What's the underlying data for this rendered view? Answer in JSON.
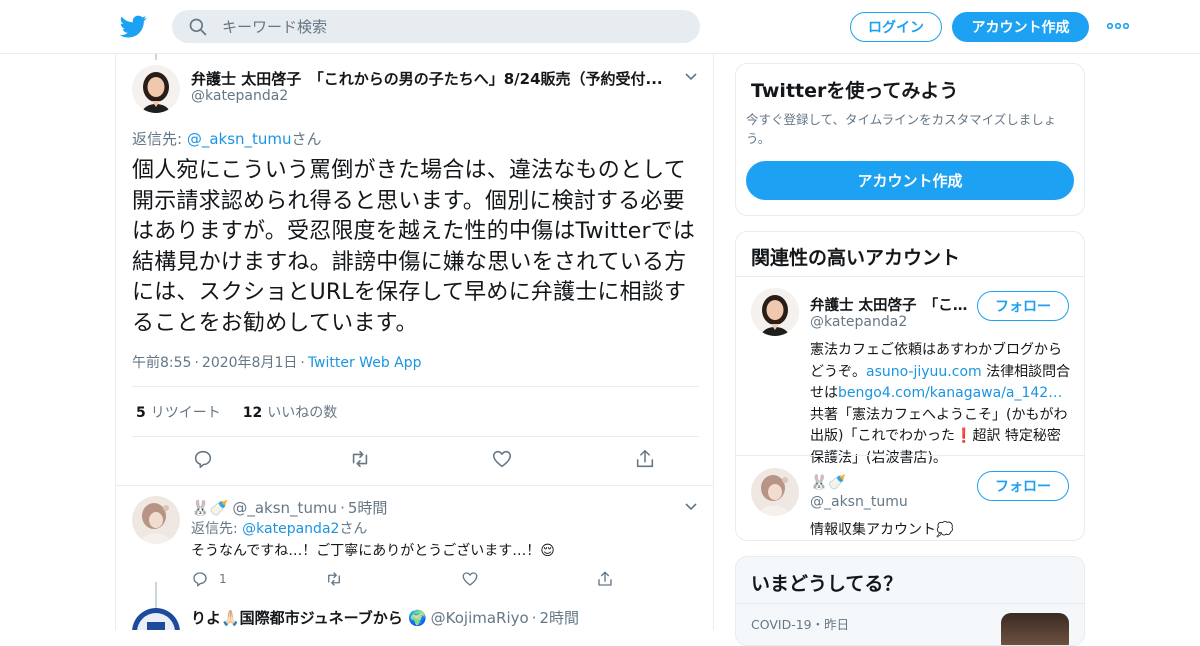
{
  "topbar": {
    "search_placeholder": "キーワード検索",
    "login_label": "ログイン",
    "signup_label": "アカウント作成",
    "brand_color": "#1da1f2"
  },
  "tweet": {
    "name": "弁護士 太田啓子　「これからの男の子たちへ」8/24販売（予約受付...",
    "handle": "@katepanda2",
    "reply_to_prefix": "返信先: ",
    "reply_to_handle": "@_aksn_tumu",
    "reply_to_suffix": "さん",
    "text": "個人宛にこういう罵倒がきた場合は、違法なものとして開示請求認められ得ると思います。個別に検討する必要はありますが。受忍限度を越えた性的中傷はTwitterでは結構見かけますね。誹謗中傷に嫌な思いをされている方には、スクショとURLを保存して早めに弁護士に相談することをお勧めしています。",
    "time": "午前8:55",
    "date": "2020年8月1日",
    "dot": "·",
    "source": "Twitter Web App",
    "retweets_count": "5",
    "retweets_label": "リツイート",
    "likes_count": "12",
    "likes_label": "いいねの数"
  },
  "replies": [
    {
      "name": "🐰🍼",
      "handle": "@_aksn_tumu",
      "time": "5時間",
      "reply_to_prefix": "返信先: ",
      "reply_to_handle": "@katepanda2",
      "reply_to_suffix": "さん",
      "text": "そうなんですね…！ご丁寧にありがとうございます…！😌",
      "reply_count": "1"
    },
    {
      "name": "りよ🙏🏻国際都市ジュネーブから 🌍",
      "handle": "@KojimaRiyo",
      "time": "2時間"
    }
  ],
  "sidebar": {
    "signup_card": {
      "title": "Twitterを使ってみよう",
      "subtitle": "今すぐ登録して、タイムラインをカスタマイズしましょう。",
      "button": "アカウント作成"
    },
    "related": {
      "title": "関連性の高いアカウント",
      "follow_label": "フォロー",
      "accounts": [
        {
          "name": "弁護士 太田啓子　「これからの男の子たちへ」",
          "handle": "@katepanda2",
          "bio_1": "憲法カフェご依頼はあすわかブログからどうぞ。",
          "link_1": "asuno-jiyuu.com",
          "bio_2": " 法律相談問合せは",
          "link_2": "bengo4.com/kanagawa/a_142…",
          "bio_3": " 共著「憲法カフェへようこそ」(かもがわ出版)「これでわかった❗️超訳 特定秘密保護法」(岩波書店)。"
        },
        {
          "name": "🐰🍼",
          "handle": "@_aksn_tumu",
          "bio": "情報収集アカウント💭"
        }
      ]
    },
    "trends": {
      "title": "いまどうしてる？",
      "meta": "COVID-19・昨日"
    }
  }
}
